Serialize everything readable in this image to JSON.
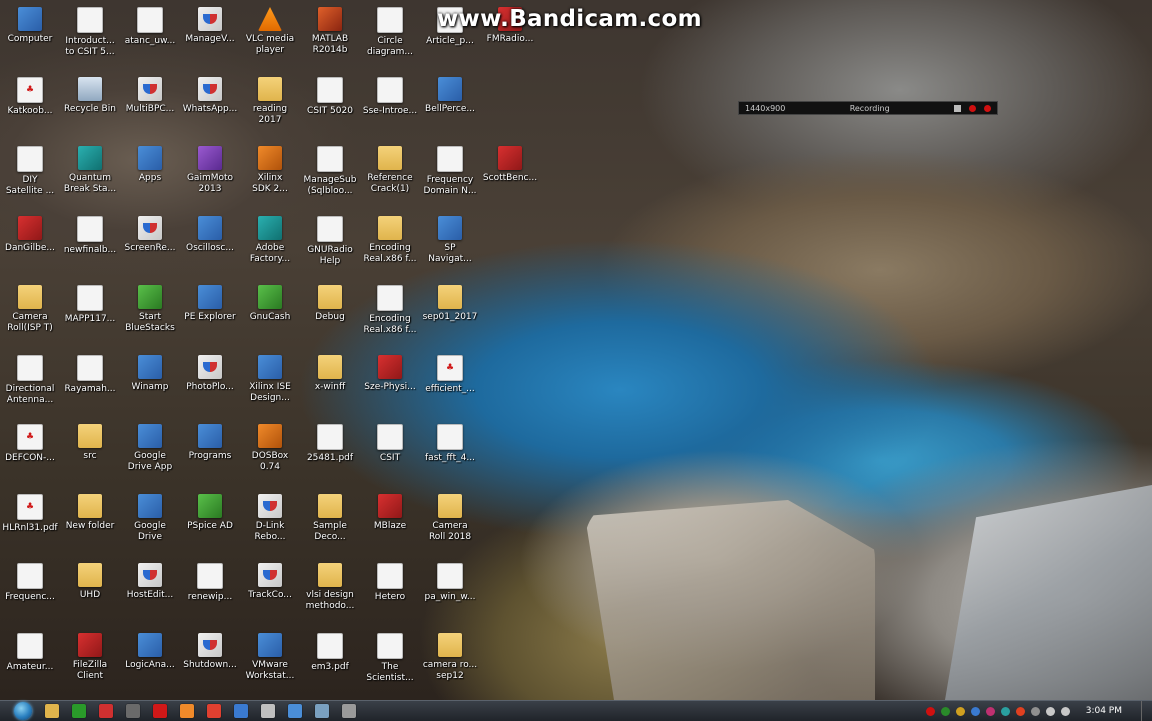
{
  "watermark": "www.Bandicam.com",
  "recorder": {
    "resolution": "1440x900",
    "status": "Recording"
  },
  "desktop_icons": [
    {
      "label": "Computer",
      "icon": "computer-icon",
      "kind": "app"
    },
    {
      "label": "Introduct...\nto CSIT 5...",
      "icon": "document-icon",
      "kind": "doc"
    },
    {
      "label": "atanc_uw...",
      "icon": "document-icon",
      "kind": "doc"
    },
    {
      "label": "ManageV...",
      "icon": "shield-icon",
      "kind": "shield"
    },
    {
      "label": "VLC media\nplayer",
      "icon": "vlc-cone-icon",
      "kind": "cone"
    },
    {
      "label": "MATLAB\nR2014b",
      "icon": "matlab-icon",
      "kind": "matlab"
    },
    {
      "label": "Circle\ndiagram...",
      "icon": "document-icon",
      "kind": "doc"
    },
    {
      "label": "Article_p...",
      "icon": "document-icon",
      "kind": "doc"
    },
    {
      "label": "FMRadio...",
      "icon": "app-icon",
      "kind": "red"
    },
    {
      "label": "Katkoob...",
      "icon": "pdf-icon",
      "kind": "pdf"
    },
    {
      "label": "Recycle Bin",
      "icon": "recycle-bin-icon",
      "kind": "bin"
    },
    {
      "label": "MultiBPC...",
      "icon": "shield-icon",
      "kind": "shield"
    },
    {
      "label": "WhatsApp...",
      "icon": "shield-icon",
      "kind": "shield"
    },
    {
      "label": "reading\n2017",
      "icon": "folder-icon",
      "kind": "folder"
    },
    {
      "label": "CSIT 5020",
      "icon": "document-icon",
      "kind": "doc"
    },
    {
      "label": "Sse-Introe...",
      "icon": "document-icon",
      "kind": "doc"
    },
    {
      "label": "BellPerce...",
      "icon": "app-icon",
      "kind": "app"
    },
    {
      "label": "DIY\nSatellite ...",
      "icon": "document-icon",
      "kind": "doc"
    },
    {
      "label": "Quantum\nBreak Sta...",
      "icon": "app-icon",
      "kind": "teal"
    },
    {
      "label": "Apps",
      "icon": "apps-icon",
      "kind": "app"
    },
    {
      "label": "GaimMoto\n2013",
      "icon": "app-icon",
      "kind": "purple"
    },
    {
      "label": "Xilinx\nSDK 2...",
      "icon": "app-icon",
      "kind": "orange"
    },
    {
      "label": "ManageSub\n(Sqlbloo...",
      "icon": "document-icon",
      "kind": "doc"
    },
    {
      "label": "Reference\nCrack(1)",
      "icon": "folder-icon",
      "kind": "folder"
    },
    {
      "label": "Frequency\nDomain N...",
      "icon": "document-icon",
      "kind": "doc"
    },
    {
      "label": "ScottBenc...",
      "icon": "app-icon",
      "kind": "red"
    },
    {
      "label": "DanGilbe...",
      "icon": "app-icon",
      "kind": "red"
    },
    {
      "label": "newfinalb...",
      "icon": "document-icon",
      "kind": "doc"
    },
    {
      "label": "ScreenRe...",
      "icon": "shield-icon",
      "kind": "shield"
    },
    {
      "label": "Oscillosc...",
      "icon": "app-icon",
      "kind": "app"
    },
    {
      "label": "Adobe\nFactory...",
      "icon": "app-icon",
      "kind": "teal"
    },
    {
      "label": "GNURadio\nHelp",
      "icon": "document-icon",
      "kind": "doc"
    },
    {
      "label": "Encoding\nReal.x86 f...",
      "icon": "folder-icon",
      "kind": "folder"
    },
    {
      "label": "SP\nNavigat...",
      "icon": "app-icon",
      "kind": "app"
    },
    {
      "label": "Camera\nRoll(ISP T)",
      "icon": "folder-icon",
      "kind": "folder"
    },
    {
      "label": "MAPP117...",
      "icon": "document-icon",
      "kind": "doc"
    },
    {
      "label": "Start\nBlueStacks",
      "icon": "bluestacks-icon",
      "kind": "green"
    },
    {
      "label": "PE Explorer",
      "icon": "app-icon",
      "kind": "app"
    },
    {
      "label": "GnuCash",
      "icon": "app-icon",
      "kind": "green"
    },
    {
      "label": "Debug",
      "icon": "folder-icon",
      "kind": "folder"
    },
    {
      "label": "Encoding\nReal.x86 f...",
      "icon": "document-icon",
      "kind": "doc"
    },
    {
      "label": "sep01_2017",
      "icon": "folder-icon",
      "kind": "folder"
    },
    {
      "label": "Directional\nAntenna...",
      "icon": "document-icon",
      "kind": "doc"
    },
    {
      "label": "Rayamah...",
      "icon": "document-icon",
      "kind": "doc"
    },
    {
      "label": "Winamp",
      "icon": "app-icon",
      "kind": "app"
    },
    {
      "label": "PhotoPlo...",
      "icon": "shield-icon",
      "kind": "shield"
    },
    {
      "label": "Xilinx ISE\nDesign...",
      "icon": "app-icon",
      "kind": "app"
    },
    {
      "label": "x-winff",
      "icon": "folder-icon",
      "kind": "folder"
    },
    {
      "label": "Sze-Physi...",
      "icon": "book-icon",
      "kind": "red"
    },
    {
      "label": "efficient_...",
      "icon": "pdf-icon",
      "kind": "pdf"
    },
    {
      "label": "DEFCON-...",
      "icon": "pdf-icon",
      "kind": "pdf"
    },
    {
      "label": "src",
      "icon": "folder-icon",
      "kind": "folder"
    },
    {
      "label": "Google\nDrive App",
      "icon": "google-drive-icon",
      "kind": "app"
    },
    {
      "label": "Programs",
      "icon": "app-icon",
      "kind": "app"
    },
    {
      "label": "DOSBox\n0.74",
      "icon": "app-icon",
      "kind": "orange"
    },
    {
      "label": "25481.pdf",
      "icon": "document-icon",
      "kind": "doc"
    },
    {
      "label": "CSIT",
      "icon": "document-icon",
      "kind": "doc"
    },
    {
      "label": "fast_fft_4...",
      "icon": "document-icon",
      "kind": "doc"
    },
    {
      "label": "HLRnl31.pdf",
      "icon": "pdf-icon",
      "kind": "pdf"
    },
    {
      "label": "New folder",
      "icon": "folder-icon",
      "kind": "folder"
    },
    {
      "label": "Google\nDrive",
      "icon": "google-drive-icon",
      "kind": "app"
    },
    {
      "label": "PSpice AD",
      "icon": "app-icon",
      "kind": "green"
    },
    {
      "label": "D-Link\nRebo...",
      "icon": "shield-icon",
      "kind": "shield"
    },
    {
      "label": "Sample\nDeco...",
      "icon": "folder-icon",
      "kind": "folder"
    },
    {
      "label": "MBlaze",
      "icon": "app-icon",
      "kind": "red"
    },
    {
      "label": "Camera\nRoll 2018",
      "icon": "folder-icon",
      "kind": "folder"
    },
    {
      "label": "Frequenc...",
      "icon": "document-icon",
      "kind": "doc"
    },
    {
      "label": "UHD",
      "icon": "folder-icon",
      "kind": "folder"
    },
    {
      "label": "HostEdit...",
      "icon": "shield-icon",
      "kind": "shield"
    },
    {
      "label": "renewip...",
      "icon": "document-icon",
      "kind": "doc"
    },
    {
      "label": "TrackCo...",
      "icon": "shield-icon",
      "kind": "shield"
    },
    {
      "label": "vlsi design\nmethodo...",
      "icon": "folder-icon",
      "kind": "folder"
    },
    {
      "label": "Hetero",
      "icon": "document-icon",
      "kind": "doc"
    },
    {
      "label": "pa_win_w...",
      "icon": "document-icon",
      "kind": "doc"
    },
    {
      "label": "Amateur...",
      "icon": "document-icon",
      "kind": "doc"
    },
    {
      "label": "FileZilla\nClient",
      "icon": "filezilla-icon",
      "kind": "red"
    },
    {
      "label": "LogicAna...",
      "icon": "app-icon",
      "kind": "app"
    },
    {
      "label": "Shutdown...",
      "icon": "shield-icon",
      "kind": "shield"
    },
    {
      "label": "VMware\nWorkstat...",
      "icon": "app-icon",
      "kind": "app"
    },
    {
      "label": "em3.pdf",
      "icon": "document-icon",
      "kind": "doc"
    },
    {
      "label": "The\nScientist...",
      "icon": "document-icon",
      "kind": "doc"
    },
    {
      "label": "camera ro...\nsep12",
      "icon": "folder-icon",
      "kind": "folder"
    }
  ],
  "taskbar_apps": [
    {
      "icon": "explorer-icon",
      "color": "#e0b44c"
    },
    {
      "icon": "media-icon",
      "color": "#2a9a2a"
    },
    {
      "icon": "app-icon",
      "color": "#d03030"
    },
    {
      "icon": "app-icon",
      "color": "#6a6a6a"
    },
    {
      "icon": "pdf-icon",
      "color": "#d01818"
    },
    {
      "icon": "app-icon",
      "color": "#f08a2a"
    },
    {
      "icon": "chrome-icon",
      "color": "#e04030"
    },
    {
      "icon": "app-icon",
      "color": "#3a7ad0"
    },
    {
      "icon": "app-icon",
      "color": "#c0c0c0"
    },
    {
      "icon": "app-icon",
      "color": "#4a8ed8"
    },
    {
      "icon": "app-icon",
      "color": "#7aa0c0"
    },
    {
      "icon": "app-icon",
      "color": "#9a9a9a"
    }
  ],
  "tray_icons": [
    {
      "icon": "tray-app-icon",
      "color": "#d01010"
    },
    {
      "icon": "tray-app-icon",
      "color": "#2a8a2a"
    },
    {
      "icon": "tray-app-icon",
      "color": "#d0a020"
    },
    {
      "icon": "tray-app-icon",
      "color": "#3a7ad0"
    },
    {
      "icon": "tray-app-icon",
      "color": "#c03070"
    },
    {
      "icon": "tray-app-icon",
      "color": "#2aa0a0"
    },
    {
      "icon": "tray-app-icon",
      "color": "#e04020"
    },
    {
      "icon": "tray-app-icon",
      "color": "#909090"
    },
    {
      "icon": "network-icon",
      "color": "#c8c8c8"
    },
    {
      "icon": "volume-icon",
      "color": "#c8c8c8"
    }
  ],
  "clock": "3:04 PM"
}
